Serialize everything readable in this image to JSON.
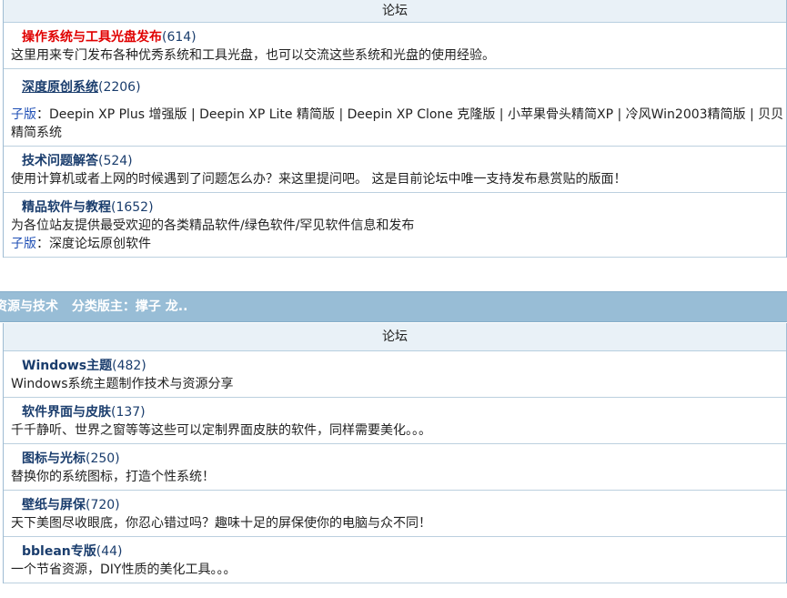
{
  "header_label": "论坛",
  "section1": [
    {
      "name": "操作系统与工具光盘发布",
      "count": "(614)",
      "desc": "这里用来专门发布各种优秀系统和工具光盘，也可以交流这些系统和光盘的使用经验。",
      "subforums_label": "",
      "subforums": ""
    },
    {
      "name": "深度原创系统",
      "count": "(2206)",
      "desc": "",
      "subforums_label": "子版",
      "subforums": "：Deepin XP Plus 增强版 | Deepin XP Lite 精简版 | Deepin XP Clone 克隆版 | 小苹果骨头精简XP | 冷风Win2003精简版 | 贝贝精简系统"
    },
    {
      "name": "技术问题解答",
      "count": "(524)",
      "desc": "使用计算机或者上网的时候遇到了问题怎么办？来这里提问吧。 这是目前论坛中唯一支持发布悬赏贴的版面！",
      "subforums_label": "",
      "subforums": ""
    },
    {
      "name": "精品软件与教程",
      "count": "(1652)",
      "desc": "为各位站友提供最受欢迎的各类精品软件/绿色软件/罕见软件信息和发布",
      "subforums_label": "子版",
      "subforums": "：深度论坛原创软件"
    }
  ],
  "category2": {
    "title": "资源与技术",
    "moderators_label": "分类版主：",
    "moderators": "撑子 龙..",
    "header_label": "论坛"
  },
  "section2": [
    {
      "name": "Windows主题",
      "count": "(482)",
      "desc": "Windows系统主题制作技术与资源分享"
    },
    {
      "name": "软件界面与皮肤",
      "count": "(137)",
      "desc": "千千静听、世界之窗等等这些可以定制界面皮肤的软件，同样需要美化。。。"
    },
    {
      "name": "图标与光标",
      "count": "(250)",
      "desc": "替换你的系统图标，打造个性系统！"
    },
    {
      "name": "壁纸与屏保",
      "count": "(720)",
      "desc": "天下美图尽收眼底，你忍心错过吗？趣味十足的屏保使你的电脑与众不同！"
    },
    {
      "name": "bblean专版",
      "count": "(44)",
      "desc": "一个节省资源，DIY性质的美化工具。。。"
    }
  ],
  "colors": {
    "accent_red": "#e00000",
    "link_blue": "#1a3d6d",
    "category_bg": "#98bdd6",
    "header_bg": "#e9f1f7"
  }
}
